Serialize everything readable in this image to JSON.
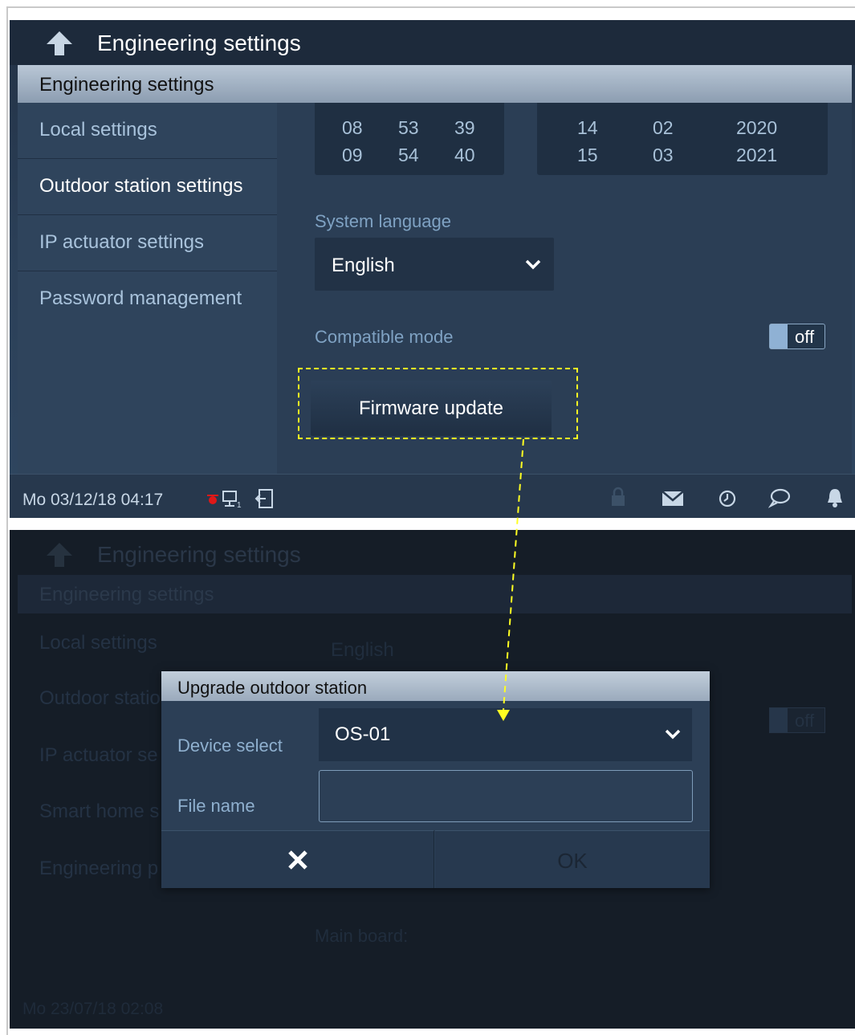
{
  "top_screen": {
    "header": {
      "title": "Engineering settings",
      "back_icon": "back-arrow-icon"
    },
    "section": {
      "title": "Engineering settings"
    },
    "sidebar": {
      "items": [
        {
          "label": "Local settings",
          "active": false
        },
        {
          "label": "Outdoor station settings",
          "active": true
        },
        {
          "label": "IP actuator settings",
          "active": false
        },
        {
          "label": "Password management",
          "active": false
        }
      ]
    },
    "time_wheel": {
      "row1": [
        "08",
        "53",
        "39"
      ],
      "row2": [
        "09",
        "54",
        "40"
      ]
    },
    "date_wheel": {
      "row1": [
        "14",
        "02",
        "2020"
      ],
      "row2": [
        "15",
        "03",
        "2021"
      ]
    },
    "system_language": {
      "label": "System language",
      "value": "English"
    },
    "compatible_mode": {
      "label": "Compatible mode",
      "state": "off"
    },
    "firmware_button": {
      "label": "Firmware update"
    },
    "status_bar": {
      "datetime": "Mo 03/12/18   04:17",
      "icons": [
        "record-icon",
        "network-icon",
        "exit-icon",
        "lock-icon",
        "mail-icon",
        "history-icon",
        "chat-icon",
        "bell-icon"
      ]
    }
  },
  "bottom_screen": {
    "background": {
      "header_title": "Engineering settings",
      "section_title": "Engineering settings",
      "sidebar_items": [
        "Local settings",
        "Outdoor statio",
        "IP actuator se",
        "Smart home s",
        "Engineering p"
      ],
      "language_value": "English",
      "toggle_state": "off",
      "main_board_label": "Main board:",
      "status_datetime": "Mo 23/07/18   02:08"
    },
    "dialog": {
      "title": "Upgrade outdoor station",
      "device_label": "Device select",
      "device_value": "OS-01",
      "file_label": "File name",
      "file_value": "",
      "cancel_icon": "close-icon",
      "ok_label": "OK"
    }
  },
  "colors": {
    "highlight": "#ffff22",
    "accent": "#8fb1d4",
    "panel": "#2b3e55"
  }
}
